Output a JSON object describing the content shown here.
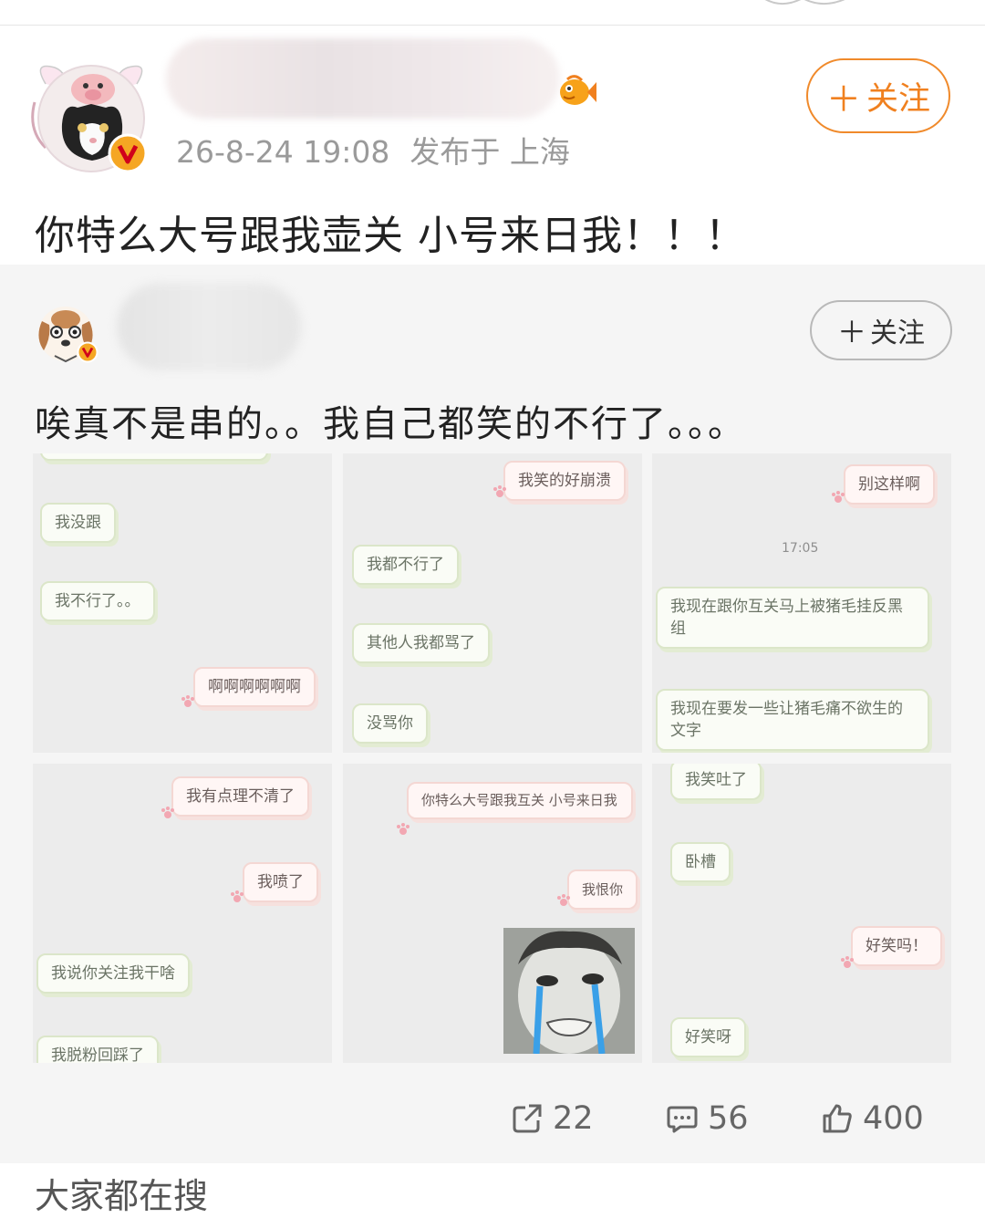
{
  "post": {
    "timestamp": "26-8-24 19:08",
    "location_text": "发布于 上海",
    "follow_label": "关注",
    "content": "你特么大号跟我壶关 小号来日我！！！"
  },
  "repost": {
    "follow_label": "关注",
    "content": "唉真不是串的。。我自己都笑的不行了。。。"
  },
  "images": [
    {
      "bubbles": [
        "我没跟",
        "我不行了。。",
        "啊啊啊啊啊啊"
      ]
    },
    {
      "bubbles": [
        "我笑的好崩溃",
        "我都不行了",
        "其他人我都骂了",
        "没骂你"
      ]
    },
    {
      "bubbles": [
        "别这样啊",
        "我现在跟你互关马上被猪毛挂反黑组",
        "我现在要发一些让猪毛痛不欲生的文字"
      ],
      "time": "17:05"
    },
    {
      "bubbles": [
        "我有点理不清了",
        "我喷了",
        "我说你关注我干啥",
        "我脱粉回踩了"
      ]
    },
    {
      "bubbles": [
        "你特么大号跟我互关 小号来日我",
        "我恨你"
      ]
    },
    {
      "bubbles": [
        "我笑吐了",
        "卧槽",
        "好笑吗！",
        "好笑呀"
      ]
    }
  ],
  "actions": {
    "repost_count": "22",
    "comment_count": "56",
    "like_count": "400"
  },
  "next_section": {
    "title": "大家都在搜"
  },
  "colors": {
    "follow_accent": "#f08a2b",
    "verified_badge": "#f5a623",
    "repost_bg": "#f5f5f5"
  },
  "icons": [
    "verified-icon",
    "fish-badge-icon",
    "paw-icon",
    "repost-icon",
    "comment-icon",
    "like-icon"
  ]
}
